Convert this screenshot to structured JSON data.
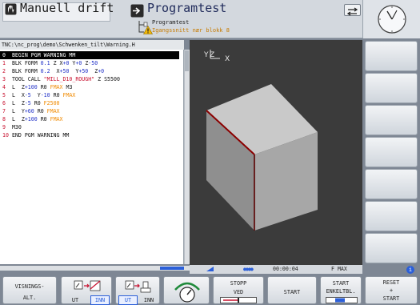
{
  "header": {
    "mode_title": "Manuell drift",
    "program_title": "Programtest",
    "program_subtitle": "Programtest",
    "program_warning": "Igangssnitt nær blokk 8"
  },
  "program": {
    "path": "TNC:\\nc_prog\\demo\\Schwenken_tilt\\Warning.H",
    "lines": [
      {
        "n": "0",
        "parts": [
          {
            "t": "BEGIN PGM WARNING MM",
            "c": ""
          }
        ],
        "selected": true
      },
      {
        "n": "1",
        "parts": [
          {
            "t": "BLK FORM ",
            "c": ""
          },
          {
            "t": "0.1",
            "c": "num"
          },
          {
            "t": " Z X",
            "c": ""
          },
          {
            "t": "+0",
            "c": "num"
          },
          {
            "t": " Y",
            "c": ""
          },
          {
            "t": "+0",
            "c": "num"
          },
          {
            "t": " Z",
            "c": ""
          },
          {
            "t": "-50",
            "c": "num"
          }
        ]
      },
      {
        "n": "2",
        "parts": [
          {
            "t": "BLK FORM ",
            "c": ""
          },
          {
            "t": "0.2",
            "c": "num"
          },
          {
            "t": "  X",
            "c": ""
          },
          {
            "t": "+50",
            "c": "num"
          },
          {
            "t": "  Y",
            "c": ""
          },
          {
            "t": "+50",
            "c": "num"
          },
          {
            "t": "  Z",
            "c": ""
          },
          {
            "t": "+0",
            "c": "num"
          }
        ]
      },
      {
        "n": "3",
        "parts": [
          {
            "t": "TOOL CALL ",
            "c": ""
          },
          {
            "t": "\"MILL_D10_ROUGH\"",
            "c": "str"
          },
          {
            "t": " Z S5500",
            "c": ""
          }
        ]
      },
      {
        "n": "4",
        "parts": [
          {
            "t": "L  Z",
            "c": ""
          },
          {
            "t": "+100",
            "c": "num"
          },
          {
            "t": " R0 ",
            "c": ""
          },
          {
            "t": "FMAX",
            "c": "fmax"
          },
          {
            "t": " M3",
            "c": ""
          }
        ]
      },
      {
        "n": "5",
        "parts": [
          {
            "t": "L  X",
            "c": ""
          },
          {
            "t": "-5",
            "c": "num"
          },
          {
            "t": "  Y",
            "c": ""
          },
          {
            "t": "-10",
            "c": "num"
          },
          {
            "t": " R0 ",
            "c": ""
          },
          {
            "t": "FMAX",
            "c": "fmax"
          }
        ]
      },
      {
        "n": "6",
        "parts": [
          {
            "t": "L  Z",
            "c": ""
          },
          {
            "t": "-5",
            "c": "num"
          },
          {
            "t": " R0 ",
            "c": ""
          },
          {
            "t": "F2500",
            "c": "fmax"
          }
        ]
      },
      {
        "n": "7",
        "parts": [
          {
            "t": "L  Y",
            "c": ""
          },
          {
            "t": "+60",
            "c": "num"
          },
          {
            "t": " R0 ",
            "c": ""
          },
          {
            "t": "FMAX",
            "c": "fmax"
          }
        ]
      },
      {
        "n": "8",
        "parts": [
          {
            "t": "L  Z",
            "c": ""
          },
          {
            "t": "+100",
            "c": "num"
          },
          {
            "t": " R0 ",
            "c": ""
          },
          {
            "t": "FMAX",
            "c": "fmax"
          }
        ]
      },
      {
        "n": "9",
        "parts": [
          {
            "t": "M30",
            "c": ""
          }
        ]
      },
      {
        "n": "10",
        "parts": [
          {
            "t": "END PGM WARNING MM",
            "c": ""
          }
        ]
      }
    ]
  },
  "view": {
    "axis_y": "Y",
    "axis_z": "Z",
    "axis_x": "X",
    "colors": {
      "bg": "#3b3b3b",
      "cube_top": "#c9c9c9",
      "cube_left": "#8f8f8f",
      "cube_front": "#a7a7a7",
      "edge": "#8b0000"
    }
  },
  "status": {
    "time": "00:00:04",
    "feed": "F MAX"
  },
  "softkeys": {
    "view_l1": "VISNINGS-",
    "view_l2": "ALT.",
    "k2_off": "UT",
    "k2_on": "INN",
    "k3_on": "UT",
    "k3_off": "INN",
    "stop_l1": "STOPP",
    "stop_l2": "VED",
    "start": "START",
    "single_l1": "START",
    "single_l2": "ENKELTBL.",
    "reset_l1": "RESET",
    "reset_l2": "+",
    "reset_l3": "START"
  }
}
